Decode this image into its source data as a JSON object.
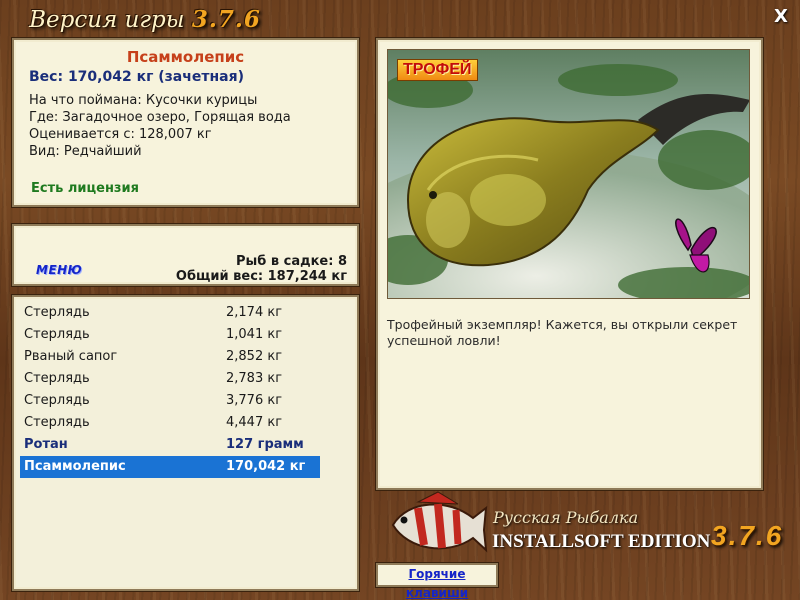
{
  "window": {
    "title_prefix": "Версия игры",
    "title_version": "3.7.6",
    "close_label": "X"
  },
  "catch": {
    "name": "Псаммолепис",
    "weight_line": "Вес: 170,042 кг (зачетная)",
    "bait_line": "На что поймана: Кусочки курицы",
    "place_line": "Где: Загадочное озеро, Горящая вода",
    "min_line": "Оцениваeтся с: 128,007 кг",
    "kind_line": "Вид: Редчайший",
    "license": "Есть лицензия"
  },
  "menu": {
    "menu_label": "МЕНЮ",
    "keepnet_line": "Рыб в садке: 8",
    "total_weight_line": "Общий вес: 187,244 кг"
  },
  "catch_list": [
    {
      "name": "Стерлядь",
      "weight": "2,174 кг"
    },
    {
      "name": "Стерлядь",
      "weight": "1,041 кг"
    },
    {
      "name": "Рваный сапог",
      "weight": "2,852 кг"
    },
    {
      "name": "Стерлядь",
      "weight": "2,783 кг"
    },
    {
      "name": "Стерлядь",
      "weight": "3,776 кг"
    },
    {
      "name": "Стерлядь",
      "weight": "4,447 кг"
    },
    {
      "name": "Ротан",
      "weight": "127 грамм"
    },
    {
      "name": "Псаммолепис",
      "weight": "170,042 кг"
    }
  ],
  "trophy": {
    "badge": "ТРОФЕЙ",
    "description": "Трофейный экземпляр! Кажется, вы открыли секрет успешной ловли!"
  },
  "brand": {
    "line1": "Русская Рыбалка",
    "line2": "INSTALLSOFT EDITION",
    "version": "3.7.6"
  },
  "hotkeys_label": "Горячие клавиши",
  "colors": {
    "accent_red": "#c6401a",
    "accent_blue": "#1a2e7a",
    "license_green": "#1f7a1f",
    "selection_blue": "#1a73d4",
    "version_orange": "#f2a521"
  }
}
